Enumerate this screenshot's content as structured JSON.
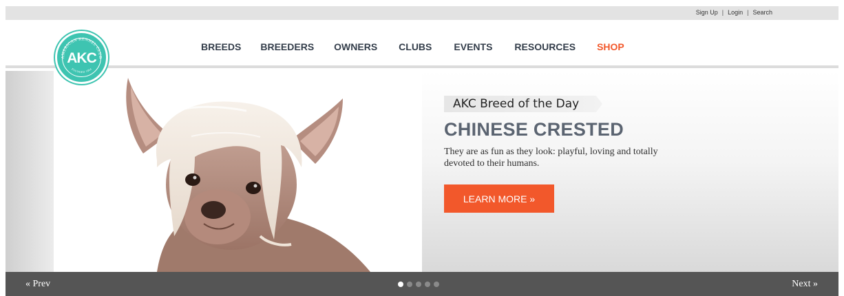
{
  "utility": {
    "links": [
      {
        "label": "Sign Up"
      },
      {
        "label": "Login"
      },
      {
        "label": "Search"
      }
    ],
    "separator": "|"
  },
  "logo": {
    "initials": "AKC",
    "arc_text": "AMERICAN KENNEL CLUB",
    "bottom_text": "FOUNDED 1884",
    "color": "#3ec4b1"
  },
  "nav": {
    "items": [
      {
        "label": "BREEDS",
        "color": "#333d4a"
      },
      {
        "label": "BREEDERS",
        "color": "#333d4a"
      },
      {
        "label": "OWNERS",
        "color": "#333d4a"
      },
      {
        "label": "CLUBS",
        "color": "#333d4a"
      },
      {
        "label": "EVENTS",
        "color": "#333d4a"
      },
      {
        "label": "RESOURCES",
        "color": "#333d4a"
      },
      {
        "label": "SHOP",
        "color": "#f2582b"
      }
    ]
  },
  "hero": {
    "eyebrow": "AKC Breed of the Day",
    "breed_name": "CHINESE CRESTED",
    "description": "They are as fun as they look: playful, loving and totally devoted to their humans.",
    "cta_label": "LEARN MORE »",
    "cta_color": "#f2582b"
  },
  "carousel": {
    "prev_label": "« Prev",
    "next_label": "Next »",
    "slide_count": 5,
    "active_index": 0
  }
}
